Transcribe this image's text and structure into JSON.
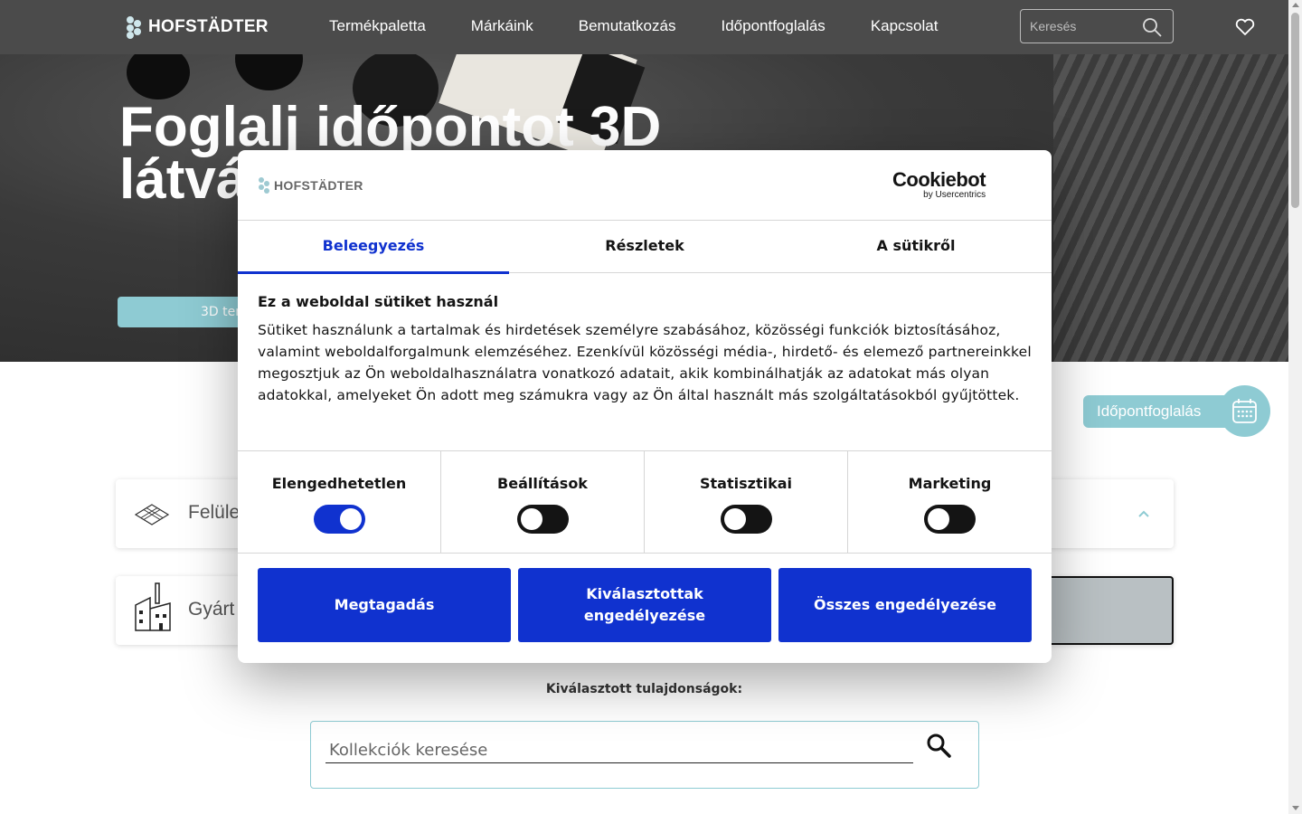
{
  "header": {
    "logo_text": "HOFSTÄDTER",
    "nav": [
      "Termékpaletta",
      "Márkáink",
      "Bemutatkozás",
      "Időpontfoglalás",
      "Kapcsolat"
    ],
    "search_placeholder": "Keresés"
  },
  "hero": {
    "title_line1": "Foglalj időpontot 3D",
    "title_line2": "látvá",
    "button_label": "3D ter"
  },
  "booking": {
    "label": "Időpontfoglalás"
  },
  "filters": {
    "surface_label": "Felüle",
    "manufacturer_label": "Gyárt"
  },
  "selected_properties_title": "Kiválasztott tulajdonságok:",
  "collection_search": {
    "placeholder": "Kollekciók keresése"
  },
  "cookie_modal": {
    "logo_text": "HOFSTÄDTER",
    "cookiebot_main": "Cookiebot",
    "cookiebot_sub": "by Usercentrics",
    "tabs": [
      "Beleegyezés",
      "Részletek",
      "A sütikről"
    ],
    "active_tab": "Beleegyezés",
    "heading": "Ez a weboldal sütiket használ",
    "body": "Sütiket használunk a tartalmak és hirdetések személyre szabásához, közösségi funkciók biztosításához, valamint weboldalforgalmunk elemzéséhez. Ezenkívül közösségi média-, hirdető- és elemező partnereinkkel megosztjuk az Ön weboldalhasználatra vonatkozó adatait, akik kombinálhatják az adatokat más olyan adatokkal, amelyeket Ön adott meg számukra vagy az Ön által használt más szolgáltatásokból gyűjtöttek.",
    "toggles": [
      {
        "label": "Elengedhetetlen",
        "on": true
      },
      {
        "label": "Beállítások",
        "on": false
      },
      {
        "label": "Statisztikai",
        "on": false
      },
      {
        "label": "Marketing",
        "on": false
      }
    ],
    "buttons": [
      "Megtagadás",
      "Kiválasztottak engedélyezése",
      "Összes engedélyezése"
    ]
  },
  "colors": {
    "topbar": "#4b4b4b",
    "accent_teal": "#8ecbd3",
    "cookie_blue": "#1032cf"
  }
}
